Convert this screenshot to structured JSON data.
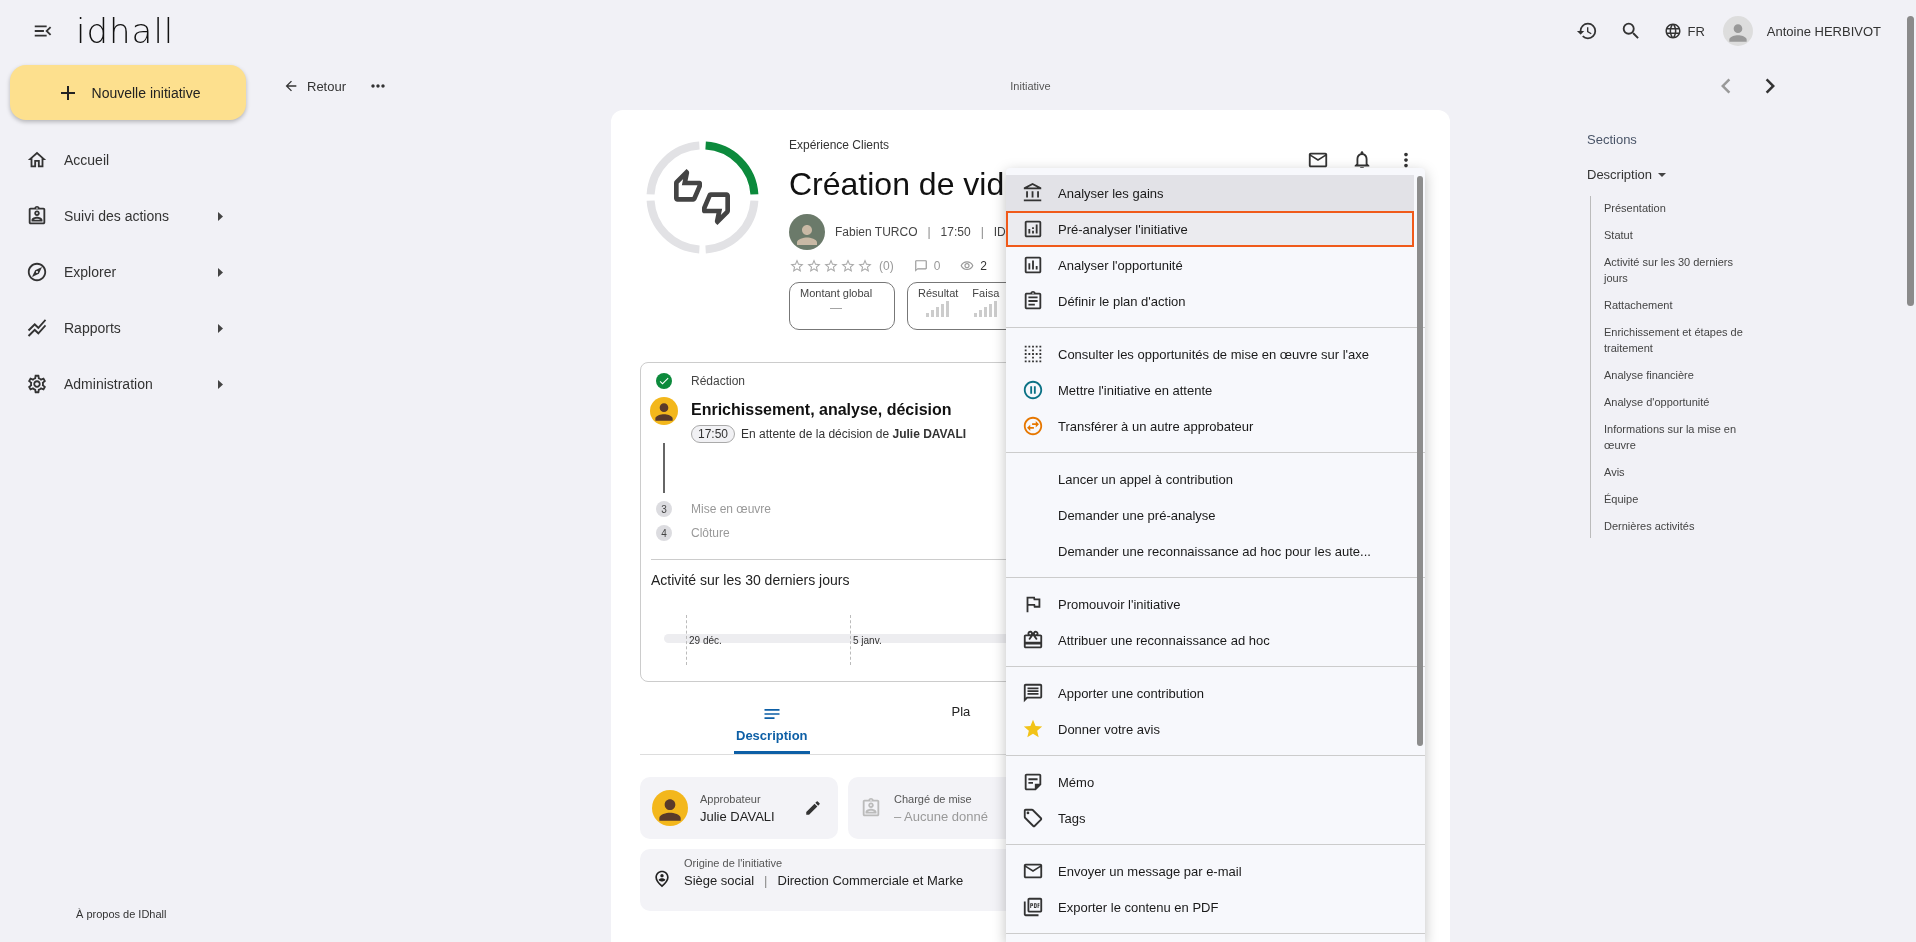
{
  "header": {
    "logo": "idhall",
    "language": "FR",
    "user": "Antoine HERBIVOT"
  },
  "sidebar": {
    "new_button": "Nouvelle initiative",
    "items": [
      {
        "label": "Accueil",
        "expandable": false
      },
      {
        "label": "Suivi des actions",
        "expandable": true
      },
      {
        "label": "Explorer",
        "expandable": true
      },
      {
        "label": "Rapports",
        "expandable": true
      },
      {
        "label": "Administration",
        "expandable": true
      }
    ],
    "footer": "À propos de IDhall"
  },
  "toolbar": {
    "back": "Retour",
    "page_title": "Initiative"
  },
  "initiative": {
    "category": "Expérience Clients",
    "title": "Création de vid",
    "author": "Fabien TURCO",
    "time": "17:50",
    "id": "ID",
    "stars": 0,
    "rating_count": "(0)",
    "comments": "0",
    "views": "2",
    "separator": "|",
    "metrics": [
      {
        "kind": "amount",
        "label": "Montant global",
        "value": "—"
      },
      {
        "kind": "rating",
        "label": "Résultat"
      },
      {
        "kind": "rating",
        "label": "Faisa"
      }
    ],
    "steps": [
      {
        "kind": "done",
        "label": "Rédaction"
      },
      {
        "kind": "current",
        "label": "Enrichissement, analyse, décision",
        "time": "17:50",
        "status": "En attente de la décision de **Julie DAVALI**"
      },
      {
        "kind": "pending",
        "number": "3",
        "label": "Mise en œuvre"
      },
      {
        "kind": "pending",
        "number": "4",
        "label": "Clôture"
      }
    ],
    "activity": {
      "title": "Activité sur les 30 derniers jours",
      "labels": [
        "29 déc.",
        "5 janv."
      ]
    },
    "tabs": [
      {
        "label": "Description",
        "selected": true
      },
      {
        "label": "Pla",
        "selected": false
      }
    ],
    "approver": {
      "label": "Approbateur",
      "value": "Julie DAVALI"
    },
    "implementer": {
      "label": "Chargé de mise",
      "value": "– Aucune donné"
    },
    "origin": {
      "label": "Origine de l'initiative",
      "site": "Siège social",
      "department": "Direction Commerciale et Marke"
    }
  },
  "menu": [
    [
      {
        "label": "Analyser les gains",
        "hovered": true,
        "selected": false
      },
      {
        "label": "Pré-analyser l'initiative",
        "hovered": false,
        "selected": true
      },
      {
        "label": "Analyser l'opportunité",
        "hovered": false,
        "selected": false
      },
      {
        "label": "Définir le plan d'action",
        "hovered": false,
        "selected": false
      }
    ],
    [
      {
        "label": "Consulter les opportunités de mise en œuvre sur l'axe",
        "hovered": false,
        "selected": false
      },
      {
        "label": "Mettre l'initiative en attente",
        "hovered": false,
        "selected": false
      },
      {
        "label": "Transférer à un autre approbateur",
        "hovered": false,
        "selected": false
      }
    ],
    [
      {
        "label": "Lancer un appel à contribution",
        "hovered": false,
        "selected": false
      },
      {
        "label": "Demander une pré-analyse",
        "hovered": false,
        "selected": false
      },
      {
        "label": "Demander une reconnaissance ad hoc pour les aute...",
        "hovered": false,
        "selected": false
      }
    ],
    [
      {
        "label": "Promouvoir l'initiative",
        "hovered": false,
        "selected": false
      },
      {
        "label": "Attribuer une reconnaissance ad hoc",
        "hovered": false,
        "selected": false
      }
    ],
    [
      {
        "label": "Apporter une contribution",
        "hovered": false,
        "selected": false
      },
      {
        "label": "Donner votre avis",
        "hovered": false,
        "selected": false
      }
    ],
    [
      {
        "label": "Mémo",
        "hovered": false,
        "selected": false
      },
      {
        "label": "Tags",
        "hovered": false,
        "selected": false
      }
    ],
    [
      {
        "label": "Envoyer un message par e-mail",
        "hovered": false,
        "selected": false
      },
      {
        "label": "Exporter le contenu en PDF",
        "hovered": false,
        "selected": false
      }
    ]
  ],
  "sections": {
    "title": "Sections",
    "group": "Description",
    "items": [
      "Présentation",
      "Statut",
      "Activité sur les 30 derniers jours",
      "Rattachement",
      "Enrichissement et étapes de traitement",
      "Analyse financière",
      "Analyse d'opportunité",
      "Informations sur la mise en œuvre",
      "Avis",
      "Équipe",
      "Dernières activités"
    ]
  }
}
